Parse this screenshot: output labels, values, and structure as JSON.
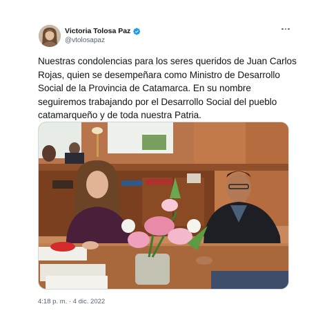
{
  "tweet": {
    "author": {
      "display_name": "Victoria Tolosa Paz",
      "handle": "@vtolosapaz",
      "verified": true,
      "avatar_icon": "profile-photo"
    },
    "more_icon": "more-horizontal-icon",
    "text": "Nuestras condolencias para los seres queridos de Juan Carlos Rojas, quien se desempeñara como Ministro de Desarrollo Social de la Provincia de Catamarca. En su nombre seguiremos trabajando por el Desarrollo Social del pueblo catamarqueño y de toda nuestra Patria.",
    "timestamp": "4:18 p. m. · 4 dic. 2022"
  },
  "colors": {
    "text_primary": "#0f1419",
    "text_secondary": "#536471",
    "verified_blue": "#1d9bf0",
    "border": "#cfd9de"
  }
}
